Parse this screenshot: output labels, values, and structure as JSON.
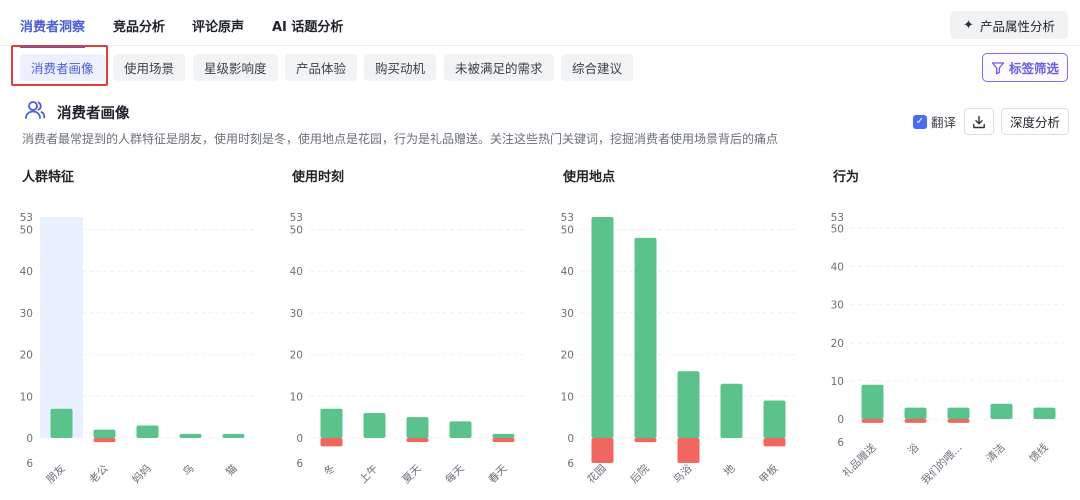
{
  "top_tabs": [
    {
      "label": "消费者洞察",
      "active": true
    },
    {
      "label": "竞品分析",
      "active": false
    },
    {
      "label": "评论原声",
      "active": false
    },
    {
      "label": "AI 话题分析",
      "active": false
    }
  ],
  "product_attr_button": "产品属性分析",
  "sub_tabs": [
    {
      "label": "消费者画像",
      "active": true
    },
    {
      "label": "使用场景",
      "active": false
    },
    {
      "label": "星级影响度",
      "active": false
    },
    {
      "label": "产品体验",
      "active": false
    },
    {
      "label": "购买动机",
      "active": false
    },
    {
      "label": "未被满足的需求",
      "active": false
    },
    {
      "label": "综合建议",
      "active": false
    }
  ],
  "filter_button": "标签筛选",
  "section": {
    "title": "消费者画像",
    "description": "消费者最常提到的人群特征是朋友，使用时刻是冬，使用地点是花园，行为是礼品赠送。关注这些热门关键词，挖掘消费者使用场景背后的痛点",
    "translate_label": "翻译",
    "translate_checked": true,
    "deep_analysis_label": "深度分析"
  },
  "colors": {
    "positive": "#5bc28b",
    "negative": "#f0675f",
    "highlight": "#e9f0ff",
    "accent": "#4a5ed8"
  },
  "chart_data": [
    {
      "type": "bar",
      "title": "人群特征",
      "categories": [
        "朋友",
        "老公",
        "妈妈",
        "鸟",
        "猫"
      ],
      "series": [
        {
          "values": [
            7,
            2,
            3,
            1,
            1
          ]
        },
        {
          "values": [
            0,
            -1,
            0,
            0,
            0
          ]
        }
      ],
      "y_ticks": [
        "53",
        "50",
        "40",
        "30",
        "20",
        "10",
        "0",
        "6"
      ],
      "ylim": [
        -6,
        53
      ],
      "highlighted_category": "朋友"
    },
    {
      "type": "bar",
      "title": "使用时刻",
      "categories": [
        "冬",
        "上午",
        "夏天",
        "每天",
        "春天"
      ],
      "series": [
        {
          "values": [
            7,
            6,
            5,
            4,
            1
          ]
        },
        {
          "values": [
            -2,
            0,
            -1,
            0,
            -1
          ]
        }
      ],
      "y_ticks": [
        "53",
        "50",
        "40",
        "30",
        "20",
        "10",
        "0",
        "6"
      ],
      "ylim": [
        -6,
        53
      ]
    },
    {
      "type": "bar",
      "title": "使用地点",
      "categories": [
        "花园",
        "后院",
        "鸟浴",
        "地",
        "甲板"
      ],
      "series": [
        {
          "values": [
            53,
            48,
            16,
            13,
            9
          ]
        },
        {
          "values": [
            -6,
            -1,
            -6,
            0,
            -2
          ]
        }
      ],
      "y_ticks": [
        "53",
        "50",
        "40",
        "30",
        "20",
        "10",
        "0",
        "6"
      ],
      "ylim": [
        -6,
        53
      ]
    },
    {
      "type": "bar",
      "title": "行为",
      "categories": [
        "礼品赠送",
        "浴",
        "我们的喂...",
        "清洁",
        "馈线"
      ],
      "series": [
        {
          "values": [
            9,
            3,
            3,
            4,
            3
          ]
        },
        {
          "values": [
            -1,
            -1,
            -1,
            0,
            0
          ]
        }
      ],
      "y_ticks": [
        "53",
        "50",
        "40",
        "30",
        "20",
        "10",
        "0",
        "6"
      ],
      "ylim": [
        -6,
        53
      ]
    }
  ]
}
